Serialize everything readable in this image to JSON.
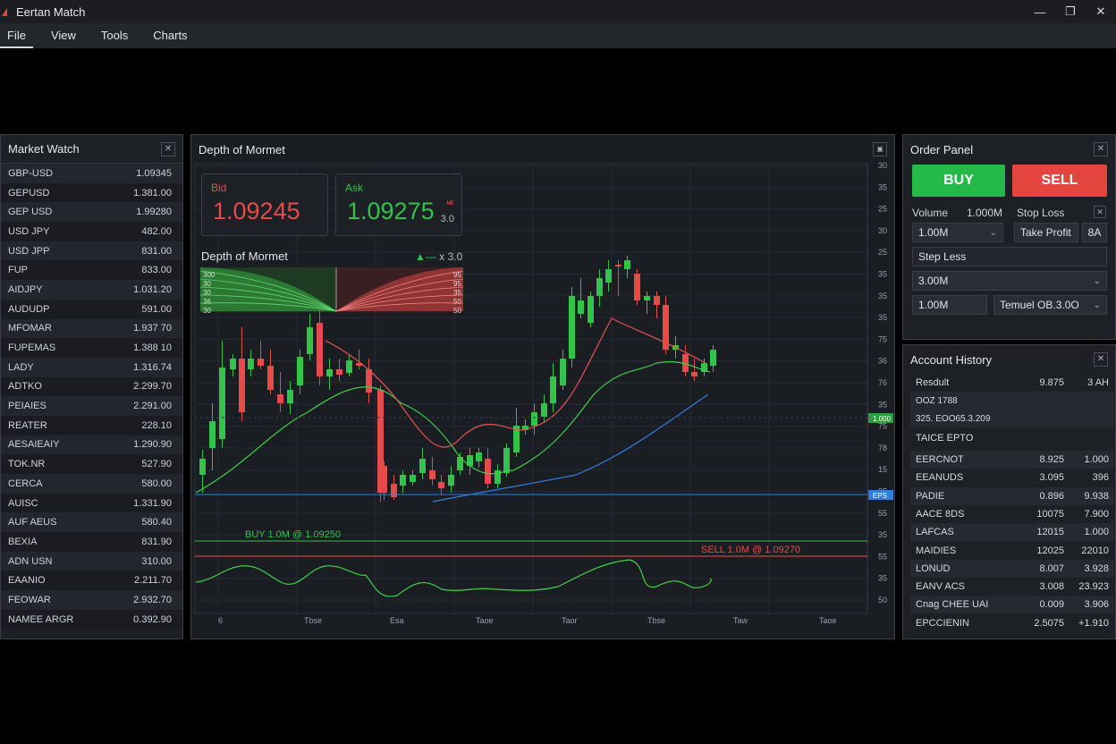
{
  "window": {
    "title": "Eertan Match"
  },
  "menu": [
    "File",
    "View",
    "Tools",
    "Charts"
  ],
  "market_watch": {
    "title": "Market Watch",
    "rows": [
      {
        "symbol": "GBP-USD",
        "value": "1.09345"
      },
      {
        "symbol": "GEPUSD",
        "value": "1.381.00"
      },
      {
        "symbol": "GEP USD",
        "value": "1.99280"
      },
      {
        "symbol": "USD JPY",
        "value": "482.00"
      },
      {
        "symbol": "USD JPP",
        "value": "831.00"
      },
      {
        "symbol": "FUP",
        "value": "833.00"
      },
      {
        "symbol": "AIDJPY",
        "value": "1.031.20"
      },
      {
        "symbol": "AUDUDP",
        "value": "591.00"
      },
      {
        "symbol": "MFOMAR",
        "value": "1.937 70"
      },
      {
        "symbol": "FUPEMAS",
        "value": "1.388 10"
      },
      {
        "symbol": "LADY",
        "value": "1.316.74"
      },
      {
        "symbol": "ADTKO",
        "value": "2.299.70"
      },
      {
        "symbol": "PEIAIES",
        "value": "2.291.00"
      },
      {
        "symbol": "REATER",
        "value": "228.10"
      },
      {
        "symbol": "AESAIEAIY",
        "value": "1.290.90"
      },
      {
        "symbol": "TOK.NR",
        "value": "527.90"
      },
      {
        "symbol": "CERCA",
        "value": "580.00"
      },
      {
        "symbol": "AUISC",
        "value": "1.331.90"
      },
      {
        "symbol": "AUF AEUS",
        "value": "580.40"
      },
      {
        "symbol": "BEXIA",
        "value": "831.90"
      },
      {
        "symbol": "ADN USN",
        "value": "310.00"
      },
      {
        "symbol": "EAANIO",
        "value": "2.211.70"
      },
      {
        "symbol": "FEOWAR",
        "value": "2.932.70"
      },
      {
        "symbol": "NAMEE ARGR",
        "value": "0.392.90"
      }
    ]
  },
  "depth": {
    "title": "Depth of Mormet",
    "bid_label": "Bid",
    "bid_value": "1.09245",
    "ask_label": "Ask",
    "ask_value": "1.09275",
    "ask_small_top": "ᴹᴱ",
    "ask_small": "3.0",
    "depth_title": "Depth of Mormet",
    "depth_marker": "x 3.0",
    "ladder_left": [
      "300",
      "30",
      "30",
      "36",
      "30"
    ],
    "ladder_right": [
      "95",
      "95",
      "35",
      "50",
      "50"
    ],
    "buy_line_label": "BUY 1.0M @ 1.09250",
    "sell_line_label": "SELL 1.0M @ 1.09270",
    "price_tag_green": "1.000",
    "price_tag_blue": "EPS",
    "y_ticks": [
      "30",
      "35",
      "25",
      "30",
      "25",
      "35",
      "35",
      "35",
      "75",
      "36",
      "76",
      "35",
      "75",
      "78",
      "15",
      "35",
      "55",
      "35",
      "55",
      "35",
      "50"
    ],
    "x_ticks": [
      "6",
      "Tbse",
      "Esa",
      "Taoe",
      "Taor",
      "Tbse",
      "Taw",
      "Taoe"
    ],
    "colors": {
      "up": "#33c24a",
      "down": "#e64b4b",
      "ma1": "#3fd14a",
      "ma2": "#e55353",
      "ma3": "#2f7fe0"
    }
  },
  "order_panel": {
    "title": "Order Panel",
    "buy_label": "BUY",
    "sell_label": "SELL",
    "volume_label": "Volume",
    "volume_value": "1.000M",
    "stop_loss_label": "Stop Loss",
    "volume_select": "1.00M",
    "take_profit_label": "Take Profit",
    "take_profit_value": "8A",
    "step_less_label": "Step Less",
    "step_select": "3.00M",
    "amount_field": "1.00M",
    "type_select": "Temuel OB.3.0O"
  },
  "account_history": {
    "title": "Account History",
    "header": {
      "c1": "Resdult",
      "c2": "9.875",
      "c3": "3 AH"
    },
    "sub1": "OOZ 1788",
    "sub2": "325. EOO65.3.209",
    "section": "TAICE EPTO",
    "rows": [
      {
        "c1": "EERCNOT",
        "c2": "8.925",
        "c3": "1.000"
      },
      {
        "c1": "EEANUDS",
        "c2": "3.095",
        "c3": "396"
      },
      {
        "c1": "PADIE",
        "c2": "0.896",
        "c3": "9.938"
      },
      {
        "c1": "AACE 8DS",
        "c2": "10075",
        "c3": "7.900"
      },
      {
        "c1": "LAFCAS",
        "c2": "12015",
        "c3": "1.000"
      },
      {
        "c1": "MAIDIES",
        "c2": "12025",
        "c3": "22010"
      },
      {
        "c1": "LONUD",
        "c2": "8.007",
        "c3": "3.928"
      },
      {
        "c1": "EANV ACS",
        "c2": "3.008",
        "c3": "23.923"
      },
      {
        "c1": "Cnag CHEE UAI",
        "c2": "0.009",
        "c3": "3.906"
      },
      {
        "c1": "EPCCIENIN",
        "c2": "2.5075",
        "c3": "+1.910"
      }
    ]
  }
}
